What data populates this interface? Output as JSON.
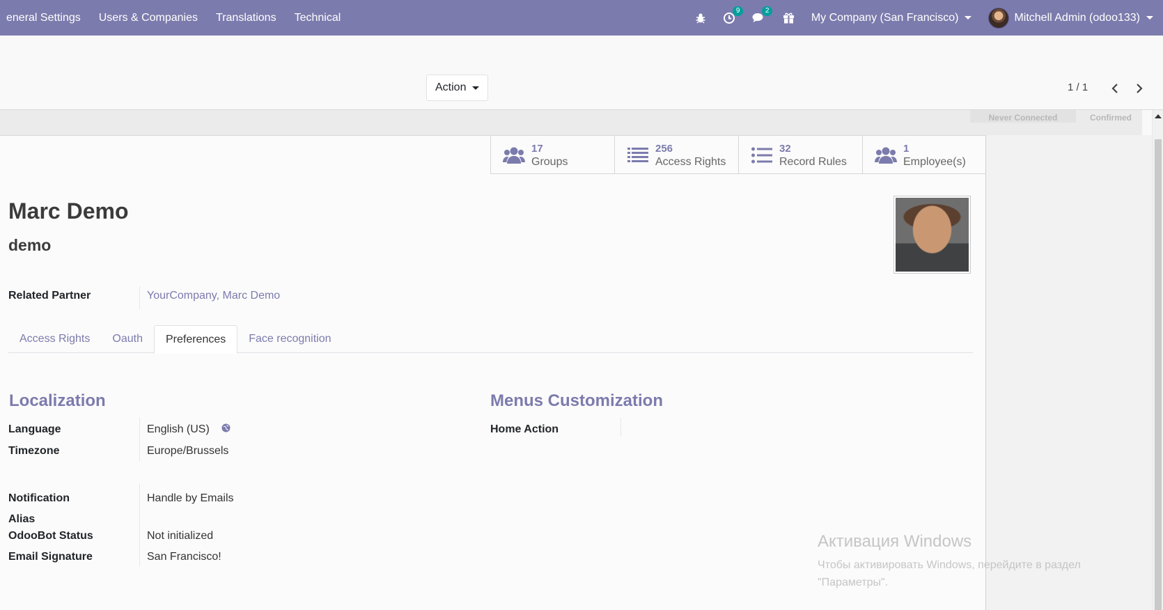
{
  "navbar": {
    "menu": [
      "eneral Settings",
      "Users & Companies",
      "Translations",
      "Technical"
    ],
    "activity_count": "9",
    "messages_count": "2",
    "company": "My Company (San Francisco)",
    "user": "Mitchell Admin (odoo133)"
  },
  "control_panel": {
    "action_label": "Action",
    "pager": "1 / 1"
  },
  "statusbar": {
    "stages": [
      "Never Connected",
      "Confirmed"
    ]
  },
  "smart_buttons": [
    {
      "value": "17",
      "label": "Groups",
      "icon": "users-icon"
    },
    {
      "value": "256",
      "label": "Access Rights",
      "icon": "list-icon"
    },
    {
      "value": "32",
      "label": "Record Rules",
      "icon": "list-ul-icon"
    },
    {
      "value": "1",
      "label": "Employee(s)",
      "icon": "users-icon"
    }
  ],
  "record": {
    "name": "Marc Demo",
    "login": "demo",
    "related_partner_label": "Related Partner",
    "related_partner_value": "YourCompany, Marc Demo"
  },
  "tabs": [
    "Access Rights",
    "Oauth",
    "Preferences",
    "Face recognition"
  ],
  "localization": {
    "title": "Localization",
    "language_label": "Language",
    "language_value": "English (US)",
    "timezone_label": "Timezone",
    "timezone_value": "Europe/Brussels"
  },
  "menus": {
    "title": "Menus Customization",
    "home_action_label": "Home Action"
  },
  "messaging": {
    "notification_label": "Notification",
    "notification_value": "Handle by Emails",
    "alias_label": "Alias",
    "odoobot_label": "OdooBot Status",
    "odoobot_value": "Not initialized",
    "signature_label": "Email Signature",
    "signature_value": "San Francisco!"
  },
  "watermark": {
    "title": "Активация Windows",
    "subtitle": "Чтобы активировать Windows, перейдите в раздел \"Параметры\"."
  },
  "colors": {
    "navbar": "#7c7bad",
    "accent": "#7c7bad",
    "badge": "#00a09d"
  }
}
